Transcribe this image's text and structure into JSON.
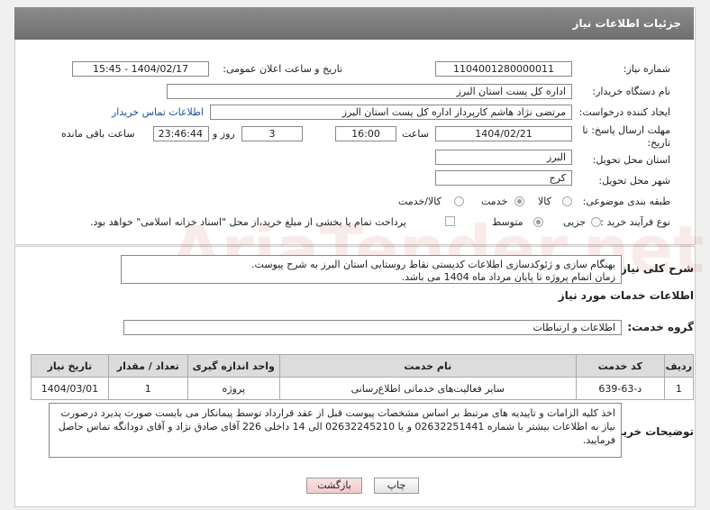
{
  "header": {
    "title": "جزئیات اطلاعات نیاز"
  },
  "form": {
    "need_number_label": "شماره نیاز:",
    "need_number": "1104001280000011",
    "announce_label": "تاریخ و ساعت اعلان عمومی:",
    "announce_value": "1404/02/17 - 15:45",
    "buyer_label": "نام دستگاه خریدار:",
    "buyer_value": "اداره کل پست استان البرز",
    "creator_label": "ایجاد کننده درخواست:",
    "creator_value": "مرتضی  نژاد هاشم کارپرداز اداره کل پست استان البرز",
    "contact_link": "اطلاعات تماس خریدار",
    "deadline_label": "مهلت ارسال پاسخ: تا تاریخ:",
    "deadline_date": "1404/02/21",
    "time_label": "ساعت",
    "deadline_time": "16:00",
    "days_value": "3",
    "days_label": "روز و",
    "remaining_time": "23:46:44",
    "remaining_label": "ساعت باقی مانده",
    "province_label": "استان محل تحویل:",
    "province_value": "البرز",
    "city_label": "شهر محل تحویل:",
    "city_value": "کرج",
    "category_label": "طبقه بندی موضوعی:",
    "category_options": [
      "کالا",
      "خدمت",
      "کالا/خدمت"
    ],
    "category_selected": "خدمت",
    "process_label": "نوع فرآیند خرید :",
    "process_options": [
      "جزیی",
      "متوسط"
    ],
    "process_selected": "متوسط",
    "payment_note": "پرداخت تمام یا بخشی از مبلغ خرید،از محل \"اسناد خزانه اسلامی\" خواهد بود."
  },
  "description": {
    "label": "شرح کلی نیاز:",
    "line1": "بهنگام سازی و ژئوکدسازی اطلاعات کدپستی نقاط روستایی استان البرز به شرح پیوست.",
    "line2": "زمان اتمام پروژه تا پایان مرداد ماه 1404 می باشد."
  },
  "services": {
    "section_title": "اطلاعات خدمات مورد نیاز",
    "group_label": "گروه خدمت:",
    "group_value": "اطلاعات و ارتباطات",
    "columns": [
      "ردیف",
      "کد خدمت",
      "نام خدمت",
      "واحد اندازه گیری",
      "تعداد / مقدار",
      "تاریخ نیاز"
    ],
    "rows": [
      [
        "1",
        "د-63-639",
        "سایر فعالیت‌های خدماتی اطلاع‌رسانی",
        "پروژه",
        "1",
        "1404/03/01"
      ]
    ]
  },
  "buyer_notes": {
    "label": "توضیحات خریدار:",
    "text": "اخذ کلیه الزامات و تاییدیه های مرتبط بر اساس مشخصات پیوست قبل از عقد قرارداد توسط پیمانکار می بایست صورت پذیرد درصورت نیاز به اطلاعات بیشتر با شماره 02632251441 و یا 02632245210 الی 14 داخلی 226 آقای صادق نژاد و آقای دودانگه تماس حاصل فرمایید."
  },
  "buttons": {
    "print": "چاپ",
    "back": "بازگشت"
  },
  "colors": {
    "header_bg": "#7a7a7a",
    "link": "#1a4f9c",
    "back_button_bg": "#f6d6d6"
  }
}
